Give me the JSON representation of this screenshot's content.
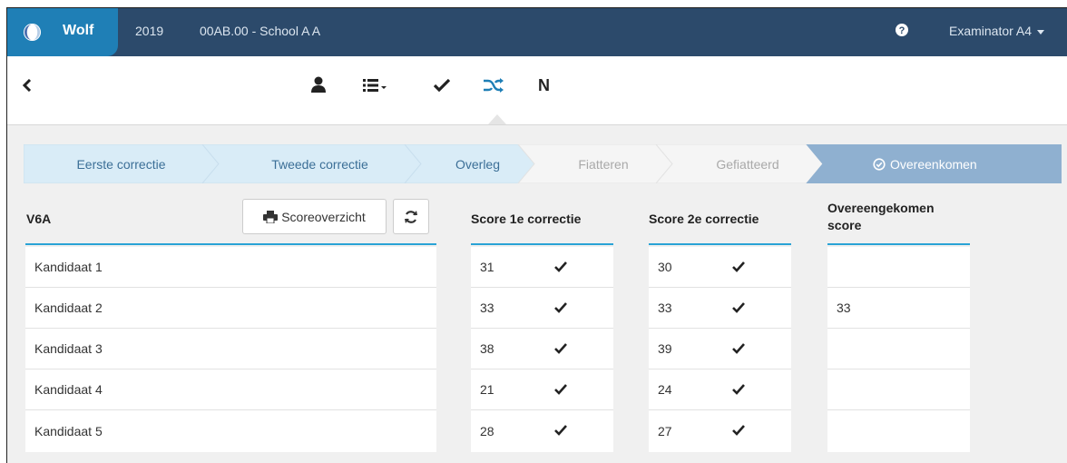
{
  "header": {
    "brand": "Wolf",
    "year": "2019",
    "school": "00AB.00 - School A A",
    "user": "Examinator A4",
    "help_icon": "question-circle-icon"
  },
  "toolbar": {
    "back_icon": "chevron-left-icon",
    "items": [
      {
        "icon": "user-icon"
      },
      {
        "icon": "list-dropdown-icon"
      },
      {
        "icon": "check-icon"
      },
      {
        "icon": "shuffle-icon",
        "active": true
      },
      {
        "icon": "n-letter-icon",
        "label": "N"
      }
    ]
  },
  "wizard": {
    "steps": [
      {
        "label": "Eerste correctie",
        "state": "done"
      },
      {
        "label": "Tweede correctie",
        "state": "done"
      },
      {
        "label": "Overleg",
        "state": "done"
      },
      {
        "label": "Fiatteren",
        "state": "pending"
      },
      {
        "label": "Gefiatteerd",
        "state": "pending"
      },
      {
        "label": "Overeenkomen",
        "state": "active",
        "icon": "check-circle-icon"
      }
    ],
    "colors": {
      "done": "#d9ecf7",
      "pending": "#f5f5f5",
      "active": "#8fb0d0"
    }
  },
  "group": {
    "title": "V6A",
    "score_button": "Scoreoverzicht",
    "refresh_icon": "refresh-icon",
    "print_icon": "print-icon"
  },
  "columns": {
    "score1": "Score 1e correctie",
    "score2": "Score 2e correctie",
    "agreed": "Overeengekomen score"
  },
  "candidates": [
    {
      "name": "Kandidaat 1",
      "score1": "31",
      "score2": "30",
      "agreed": ""
    },
    {
      "name": "Kandidaat 2",
      "score1": "33",
      "score2": "33",
      "agreed": "33"
    },
    {
      "name": "Kandidaat 3",
      "score1": "38",
      "score2": "39",
      "agreed": ""
    },
    {
      "name": "Kandidaat 4",
      "score1": "21",
      "score2": "24",
      "agreed": ""
    },
    {
      "name": "Kandidaat 5",
      "score1": "28",
      "score2": "27",
      "agreed": ""
    }
  ],
  "accent": "#2aa3d6"
}
